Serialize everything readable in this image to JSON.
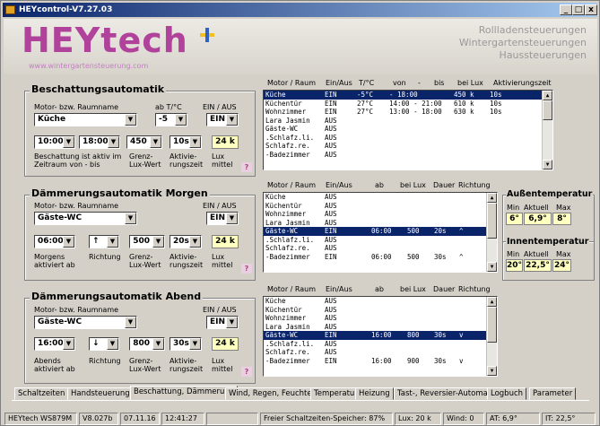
{
  "window": {
    "title": "HEYcontrol-V7.27.03",
    "buttons": [
      "_",
      "□",
      "x"
    ]
  },
  "header": {
    "logo": "HEYtech",
    "url": "www.wintergartensteuerung.com",
    "slogans": [
      "Rollladensteuerungen",
      "Wintergartensteuerungen",
      "Haussteuerungen"
    ]
  },
  "beschattung": {
    "title": "Beschattungsautomatik",
    "label_room": "Motor- bzw. Raumname",
    "label_abt": "ab T/°C",
    "label_einaus": "EIN / AUS",
    "room": "Küche",
    "temp": "-5",
    "einaus": "EIN",
    "from": "10:00",
    "to": "18:00",
    "lux": "450 k",
    "akt": "10s",
    "luxmittel": "24 k",
    "lbl_aktiv": "Beschattung ist aktiv im Zeitraum von - bis",
    "lbl_grenz": "Grenz-Lux-Wert",
    "lbl_aktiv2": "Aktivie-rungszeit",
    "lbl_luxmittel": "Lux mittel",
    "help": "?"
  },
  "list1": {
    "headers": [
      "Motor / Raum",
      "Ein/Aus",
      "T/°C",
      "von",
      "-",
      "bis",
      "bei Lux",
      "Aktivierungszeit"
    ],
    "rows": [
      {
        "name": "Küche",
        "ea": "EIN",
        "t": "-5°C",
        "vb": "- 18:00",
        "lux": "450 k",
        "z": "10s",
        "selected": true
      },
      {
        "name": "Küchentür",
        "ea": "EIN",
        "t": "27°C",
        "vb": "14:00 - 21:00",
        "lux": "610 k",
        "z": "10s"
      },
      {
        "name": "Wohnzimmer",
        "ea": "EIN",
        "t": "27°C",
        "vb": "13:00 - 18:00",
        "lux": "630 k",
        "z": "10s"
      },
      {
        "name": "Lara Jasmin",
        "ea": "AUS"
      },
      {
        "name": "Gäste-WC",
        "ea": "AUS"
      },
      {
        "name": ".Schlafz.li.",
        "ea": "AUS"
      },
      {
        "name": "Schlafz.re.",
        "ea": "AUS"
      },
      {
        "name": "-Badezimmer",
        "ea": "AUS"
      }
    ]
  },
  "morgen": {
    "title": "Dämmerungsautomatik Morgen",
    "label_room": "Motor- bzw. Raumname",
    "label_einaus": "EIN / AUS",
    "room": "Gäste-WC",
    "einaus": "EIN",
    "time": "06:00",
    "dir": "↑",
    "lux": "500",
    "akt": "20s",
    "luxmittel": "24 k",
    "lbl_time": "Morgens aktiviert ab",
    "lbl_dir": "Richtung",
    "lbl_grenz": "Grenz-Lux-Wert",
    "lbl_akt": "Aktivie-rungszeit",
    "lbl_luxmittel": "Lux mittel",
    "help": "?"
  },
  "list2": {
    "headers": [
      "Motor / Raum",
      "Ein/Aus",
      "ab",
      "bei Lux",
      "Dauer",
      "Richtung"
    ],
    "rows": [
      {
        "name": "Küche",
        "ea": "AUS"
      },
      {
        "name": "Küchentür",
        "ea": "AUS"
      },
      {
        "name": "Wohnzimmer",
        "ea": "AUS"
      },
      {
        "name": "Lara Jasmin",
        "ea": "AUS"
      },
      {
        "name": "Gäste-WC",
        "ea": "EIN",
        "ab": "06:00",
        "lux": "500",
        "d": "20s",
        "r": "^",
        "selected": true
      },
      {
        "name": ".Schlafz.li.",
        "ea": "AUS"
      },
      {
        "name": "Schlafz.re.",
        "ea": "AUS"
      },
      {
        "name": "-Badezimmer",
        "ea": "EIN",
        "ab": "06:00",
        "lux": "500",
        "d": "30s",
        "r": "^"
      }
    ]
  },
  "abend": {
    "title": "Dämmerungsautomatik Abend",
    "label_room": "Motor- bzw. Raumname",
    "label_einaus": "EIN / AUS",
    "room": "Gäste-WC",
    "einaus": "EIN",
    "time": "16:00",
    "dir": "↓",
    "lux": "800",
    "akt": "30s",
    "luxmittel": "24 k",
    "lbl_time": "Abends aktiviert ab",
    "lbl_dir": "Richtung",
    "lbl_grenz": "Grenz-Lux-Wert",
    "lbl_akt": "Aktivie-rungszeit",
    "lbl_luxmittel": "Lux mittel",
    "help": "?"
  },
  "list3": {
    "headers": [
      "Motor / Raum",
      "Ein/Aus",
      "ab",
      "bei Lux",
      "Dauer",
      "Richtung"
    ],
    "rows": [
      {
        "name": "Küche",
        "ea": "AUS"
      },
      {
        "name": "Küchentür",
        "ea": "AUS"
      },
      {
        "name": "Wohnzimmer",
        "ea": "AUS"
      },
      {
        "name": "Lara Jasmin",
        "ea": "AUS"
      },
      {
        "name": "Gäste-WC",
        "ea": "EIN",
        "ab": "16:00",
        "lux": "800",
        "d": "30s",
        "r": "v",
        "selected": true
      },
      {
        "name": ".Schlafz.li.",
        "ea": "AUS"
      },
      {
        "name": "Schlafz.re.",
        "ea": "AUS"
      },
      {
        "name": "-Badezimmer",
        "ea": "EIN",
        "ab": "16:00",
        "lux": "900",
        "d": "30s",
        "r": "v"
      }
    ]
  },
  "aussen": {
    "title": "Außentemperatur",
    "h_min": "Min",
    "h_akt": "Aktuell",
    "h_max": "Max",
    "min": "6°",
    "akt": "6,9°",
    "max": "8°"
  },
  "innen": {
    "title": "Innentemperatur",
    "h_min": "Min",
    "h_akt": "Aktuell",
    "h_max": "Max",
    "min": "20°",
    "akt": "22,5°",
    "max": "24°"
  },
  "tabs": [
    "Schaltzeiten",
    "Handsteuerung",
    "Beschattung, Dämmerung",
    "Wind, Regen, Feuchte",
    "Temperatur",
    "Heizung",
    "Tast-, Reversier-Automatik",
    "Logbuch",
    "Parameter"
  ],
  "status": {
    "device": "HEYtech WS879M",
    "version": "V8.027b",
    "date": "07.11.16",
    "time": "12:41:27",
    "memory": "Freier Schaltzeiten-Speicher: 87%",
    "lux": "Lux: 20 k",
    "wind": "Wind: 0",
    "at": "AT: 6,9°",
    "it": "IT: 22,5°"
  }
}
